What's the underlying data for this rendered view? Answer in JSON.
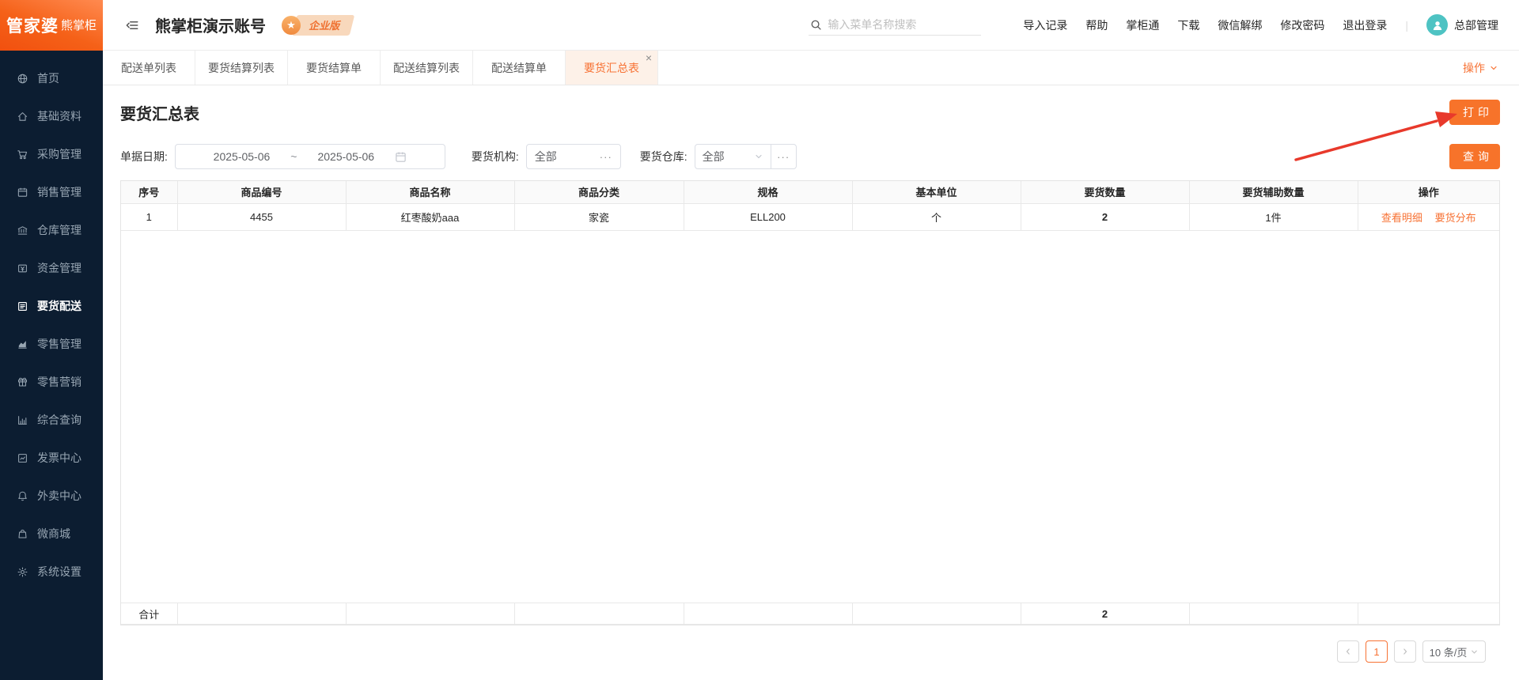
{
  "header": {
    "logo_brand": "管家婆",
    "logo_product": "熊掌柜",
    "account_title": "熊掌柜演示账号",
    "plan_badge": "企业版",
    "search_placeholder": "输入菜单名称搜索",
    "links": [
      "导入记录",
      "帮助",
      "掌柜通",
      "下载",
      "微信解绑",
      "修改密码",
      "退出登录"
    ],
    "username": "总部管理"
  },
  "sidebar": {
    "items": [
      {
        "label": "首页",
        "icon": "globe-icon"
      },
      {
        "label": "基础资料",
        "icon": "home-icon"
      },
      {
        "label": "采购管理",
        "icon": "cart-icon"
      },
      {
        "label": "销售管理",
        "icon": "calendar-icon"
      },
      {
        "label": "仓库管理",
        "icon": "bank-icon"
      },
      {
        "label": "资金管理",
        "icon": "cash-icon"
      },
      {
        "label": "要货配送",
        "icon": "delivery-list-icon",
        "active": true
      },
      {
        "label": "零售管理",
        "icon": "area-chart-icon"
      },
      {
        "label": "零售营销",
        "icon": "gift-icon"
      },
      {
        "label": "综合查询",
        "icon": "bar-chart-icon"
      },
      {
        "label": "发票中心",
        "icon": "invoice-chart-icon"
      },
      {
        "label": "外卖中心",
        "icon": "bell-icon"
      },
      {
        "label": "微商城",
        "icon": "shop-bag-icon"
      },
      {
        "label": "系统设置",
        "icon": "gear-icon"
      }
    ]
  },
  "tabs": {
    "items": [
      {
        "label": "配送单列表"
      },
      {
        "label": "要货结算列表"
      },
      {
        "label": "要货结算单"
      },
      {
        "label": "配送结算列表"
      },
      {
        "label": "配送结算单"
      },
      {
        "label": "要货汇总表",
        "active": true,
        "closable": true
      }
    ],
    "actions_label": "操作"
  },
  "page": {
    "title": "要货汇总表",
    "print_button": "打印",
    "query_button": "查询",
    "filters": {
      "date_label": "单据日期:",
      "date_from": "2025-05-06",
      "date_separator": "~",
      "date_to": "2025-05-06",
      "org_label": "要货机构:",
      "org_value": "全部",
      "warehouse_label": "要货仓库:",
      "warehouse_value": "全部"
    },
    "table": {
      "columns": [
        "序号",
        "商品编号",
        "商品名称",
        "商品分类",
        "规格",
        "基本单位",
        "要货数量",
        "要货辅助数量",
        "操作"
      ],
      "rows": [
        {
          "seq": "1",
          "code": "4455",
          "name": "红枣酸奶aaa",
          "category": "家瓷",
          "spec": "ELL200",
          "unit": "个",
          "qty": "2",
          "aux_qty": "1件",
          "action1": "查看明细",
          "action2": "要货分布"
        }
      ],
      "footer_label": "合计",
      "footer_qty_total": "2"
    },
    "pagination": {
      "current_page": "1",
      "page_size": "10 条/页"
    }
  },
  "icons": {
    "star": "★",
    "close": "×",
    "ellipsis": "···"
  },
  "colors": {
    "primary": "#f77234",
    "sidebar_bg": "#0c1d31",
    "arrow": "#e8392b"
  }
}
